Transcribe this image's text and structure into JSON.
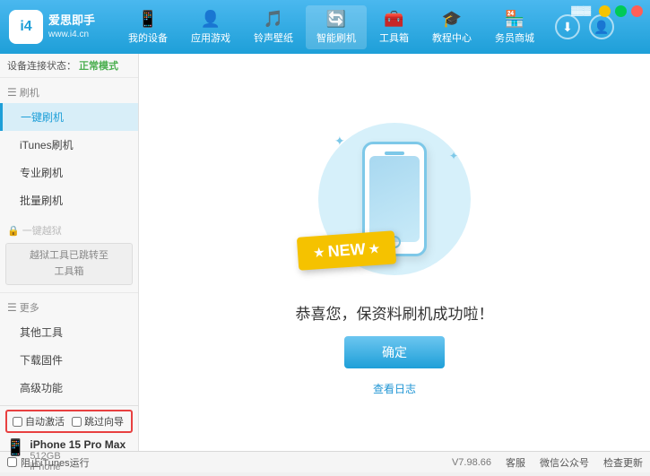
{
  "app": {
    "logo_icon": "i4",
    "logo_brand": "爱思即手",
    "logo_url": "www.i4.cn"
  },
  "nav": {
    "items": [
      {
        "id": "my-device",
        "icon": "📱",
        "label": "我的设备"
      },
      {
        "id": "app-games",
        "icon": "👤",
        "label": "应用游戏"
      },
      {
        "id": "ringtones",
        "icon": "🎵",
        "label": "铃声壁纸"
      },
      {
        "id": "smart-flash",
        "icon": "🔄",
        "label": "智能刷机",
        "active": true
      },
      {
        "id": "toolbox",
        "icon": "🧰",
        "label": "工具箱"
      },
      {
        "id": "tutorial",
        "icon": "🎓",
        "label": "教程中心"
      },
      {
        "id": "merchant",
        "icon": "🏪",
        "label": "务员商城"
      }
    ]
  },
  "sidebar": {
    "status_label": "设备连接状态：",
    "status_mode": "正常模式",
    "section_flash": "刷机",
    "items": [
      {
        "id": "one-click-flash",
        "label": "一键刷机",
        "active": true
      },
      {
        "id": "itunes-flash",
        "label": "iTunes刷机",
        "active": false
      },
      {
        "id": "pro-flash",
        "label": "专业刷机",
        "active": false
      },
      {
        "id": "batch-flash",
        "label": "批量刷机",
        "active": false
      }
    ],
    "disabled_label": "一键越狱",
    "disabled_note_line1": "越狱工具已跳转至",
    "disabled_note_line2": "工具箱",
    "section_more": "更多",
    "more_items": [
      {
        "id": "other-tools",
        "label": "其他工具"
      },
      {
        "id": "download-firmware",
        "label": "下载固件"
      },
      {
        "id": "advanced",
        "label": "高级功能"
      }
    ]
  },
  "main": {
    "new_badge": "NEW",
    "success_text": "恭喜您，保资料刷机成功啦！",
    "confirm_btn": "确定",
    "log_link": "查看日志"
  },
  "device": {
    "auto_activate_label": "自动激活",
    "guide_label": "跳过向导",
    "name": "iPhone 15 Pro Max",
    "storage": "512GB",
    "type": "iPhone"
  },
  "footer": {
    "version": "V7.98.66",
    "links": [
      "客服",
      "微信公众号",
      "检查更新"
    ],
    "itunes_label": "阻止iTunes运行"
  },
  "window": {
    "minimize": "−",
    "maximize": "□",
    "close": "×"
  }
}
